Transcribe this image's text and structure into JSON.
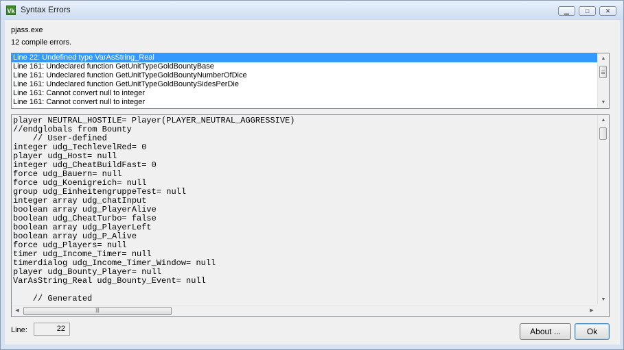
{
  "window": {
    "title": "Syntax Errors",
    "app_icon_text": "Vk",
    "controls": {
      "minimize": "▁",
      "maximize": "□",
      "close": "✕"
    }
  },
  "program": "pjass.exe",
  "summary": "12 compile errors.",
  "errors": [
    "Line 22:  Undefined type VarAsString_Real",
    "Line 161:  Undeclared function GetUnitTypeGoldBountyBase",
    "Line 161:  Undeclared function GetUnitTypeGoldBountyNumberOfDice",
    "Line 161:  Undeclared function GetUnitTypeGoldBountySidesPerDie",
    "Line 161:  Cannot convert null to integer",
    "Line 161:  Cannot convert null to integer"
  ],
  "selected_error_index": 0,
  "code_lines": [
    "player NEUTRAL_HOSTILE= Player(PLAYER_NEUTRAL_AGGRESSIVE)",
    "//endglobals from Bounty",
    "    // User-defined",
    "integer udg_TechlevelRed= 0",
    "player udg_Host= null",
    "integer udg_CheatBuildFast= 0",
    "force udg_Bauern= null",
    "force udg_Koenigreich= null",
    "group udg_EinheitengruppeTest= null",
    "integer array udg_chatInput",
    "boolean array udg_PlayerAlive",
    "boolean udg_CheatTurbo= false",
    "boolean array udg_PlayerLeft",
    "boolean array udg_P_Alive",
    "force udg_Players= null",
    "timer udg_Income_Timer= null",
    "timerdialog udg_Income_Timer_Window= null",
    "player udg_Bounty_Player= null",
    "VarAsString_Real udg_Bounty_Event= null",
    "",
    "    // Generated"
  ],
  "line_label": "Line:",
  "line_value": "22",
  "buttons": {
    "about": "About ...",
    "ok": "Ok"
  },
  "colors": {
    "selection": "#3399ff",
    "title_bar": "#cddcf0"
  }
}
